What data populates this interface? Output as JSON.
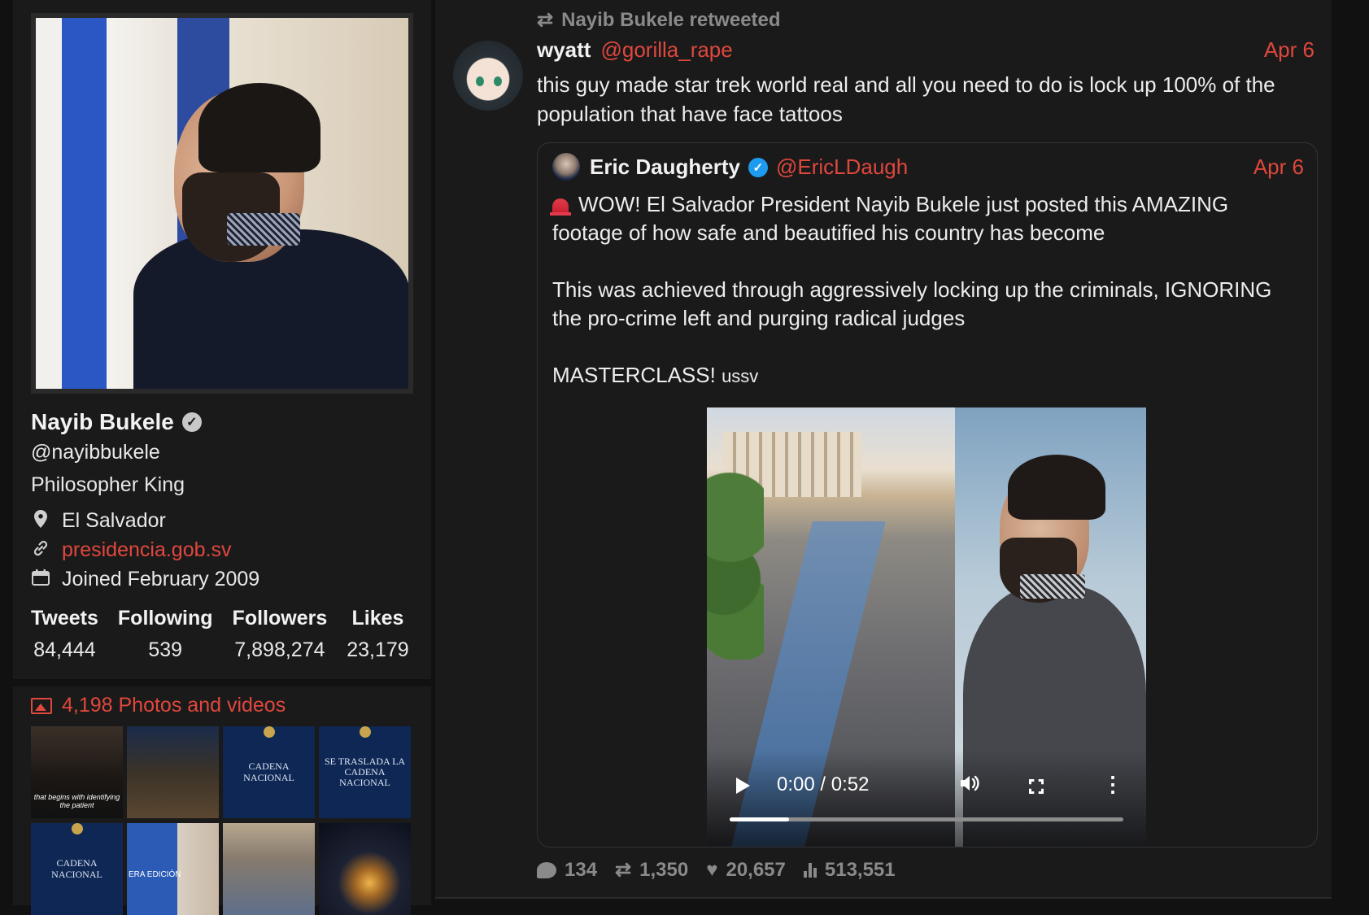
{
  "profile": {
    "name": "Nayib Bukele",
    "handle": "@nayibbukele",
    "bio": "Philosopher King",
    "location": "El Salvador",
    "website": "presidencia.gob.sv",
    "joined": "Joined February 2009",
    "stats": [
      {
        "label": "Tweets",
        "value": "84,444"
      },
      {
        "label": "Following",
        "value": "539"
      },
      {
        "label": "Followers",
        "value": "7,898,274"
      },
      {
        "label": "Likes",
        "value": "23,179"
      }
    ],
    "icons": [
      "location-pin-icon",
      "link-icon",
      "calendar-icon",
      "verified-icon"
    ]
  },
  "media": {
    "header": "4,198 Photos and videos",
    "thumbnails": [
      {
        "text": "",
        "caption": "that begins with identifying the patient"
      },
      {
        "text": "",
        "caption": ""
      },
      {
        "text": "CADENA NACIONAL",
        "caption": ""
      },
      {
        "text": "SE TRASLADA LA CADENA NACIONAL",
        "caption": ""
      },
      {
        "text": "CADENA NACIONAL",
        "caption": ""
      },
      {
        "text": "ERA EDICIÓN",
        "caption": ""
      },
      {
        "text": "",
        "caption": ""
      },
      {
        "text": "",
        "caption": ""
      }
    ]
  },
  "tweet": {
    "retweet_label": "Nayib Bukele retweeted",
    "author": "wyatt",
    "handle": "@gorilla_rape",
    "date": "Apr 6",
    "text": "this guy made star trek world real and all you need to do is lock up 100% of the population that have face tattoos",
    "stats": {
      "replies": "134",
      "retweets": "1,350",
      "likes": "20,657",
      "views": "513,551"
    }
  },
  "quote": {
    "author": "Eric Daugherty",
    "handle": "@EricLDaugh",
    "date": "Apr 6",
    "paragraph1": "WOW! El Salvador President Nayib Bukele just posted this AMAZING footage of how safe and beautified his country has become",
    "paragraph2": "This was achieved through aggressively locking up the criminals, IGNORING the pro-crime left and purging radical judges",
    "paragraph3": "MASTERCLASS!",
    "paragraph3_suffix": "ussv",
    "video": {
      "time": "0:00 / 0:52",
      "progress": 0.15
    }
  },
  "colors": {
    "accent_red": "#e0473d",
    "background": "#111111",
    "panel": "#1a1a1a",
    "verified_blue": "#1d9bf0"
  }
}
